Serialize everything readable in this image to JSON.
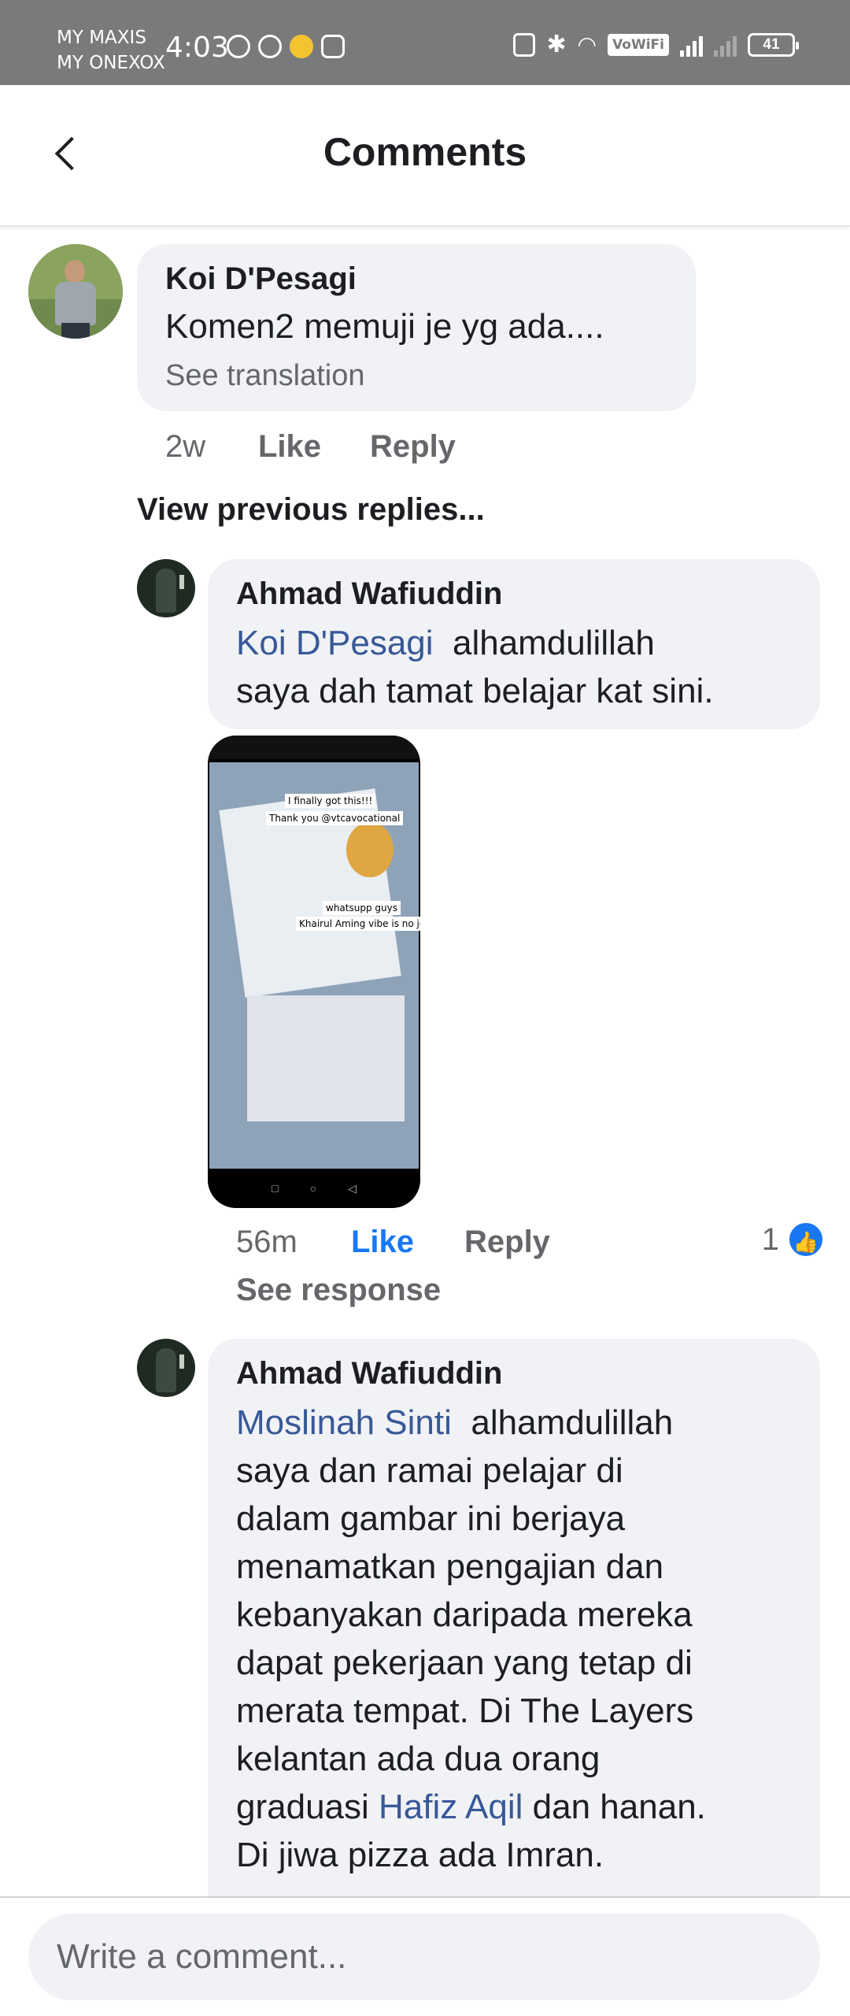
{
  "status_bar": {
    "carrier1": "MY MAXIS",
    "carrier2": "MY ONEXOX",
    "time": "4:03",
    "vowifi": "VoWiFi",
    "battery": "41"
  },
  "header": {
    "title": "Comments"
  },
  "comments": [
    {
      "author": "Koi D'Pesagi",
      "text": "Komen2 memuji je yg ada....",
      "translation": "See translation",
      "time": "2w",
      "like": "Like",
      "reply": "Reply"
    }
  ],
  "view_previous": "View previous replies...",
  "replies": [
    {
      "author": "Ahmad Wafiuddin",
      "mention": "Koi D'Pesagi",
      "text_line1": "alhamdulillah",
      "text_line2": "saya dah tamat belajar kat sini.",
      "attachment_captions": [
        "I finally got this!!!",
        "Thank you @vtcavocational",
        "whatsupp guys",
        "Khairul Aming vibe is no joke"
      ],
      "time": "56m",
      "like": "Like",
      "reply": "Reply",
      "like_count": "1",
      "see_response": "See response"
    },
    {
      "author": "Ahmad Wafiuddin",
      "mention": "Moslinah Sinti",
      "lines": [
        "alhamdulillah",
        "saya dan ramai pelajar di",
        "dalam gambar ini berjaya",
        "menamatkan pengajian dan",
        "kebanyakan daripada mereka",
        "dapat pekerjaan yang tetap di",
        "merata tempat. Di The Layers",
        "kelantan ada dua orang"
      ],
      "line9_pre": "graduasi",
      "line9_mention": "Hafiz Aqil",
      "line9_post": "dan hanan.",
      "line10": "Di jiwa pizza ada Imran."
    }
  ],
  "composer": {
    "placeholder": "Write a comment..."
  }
}
